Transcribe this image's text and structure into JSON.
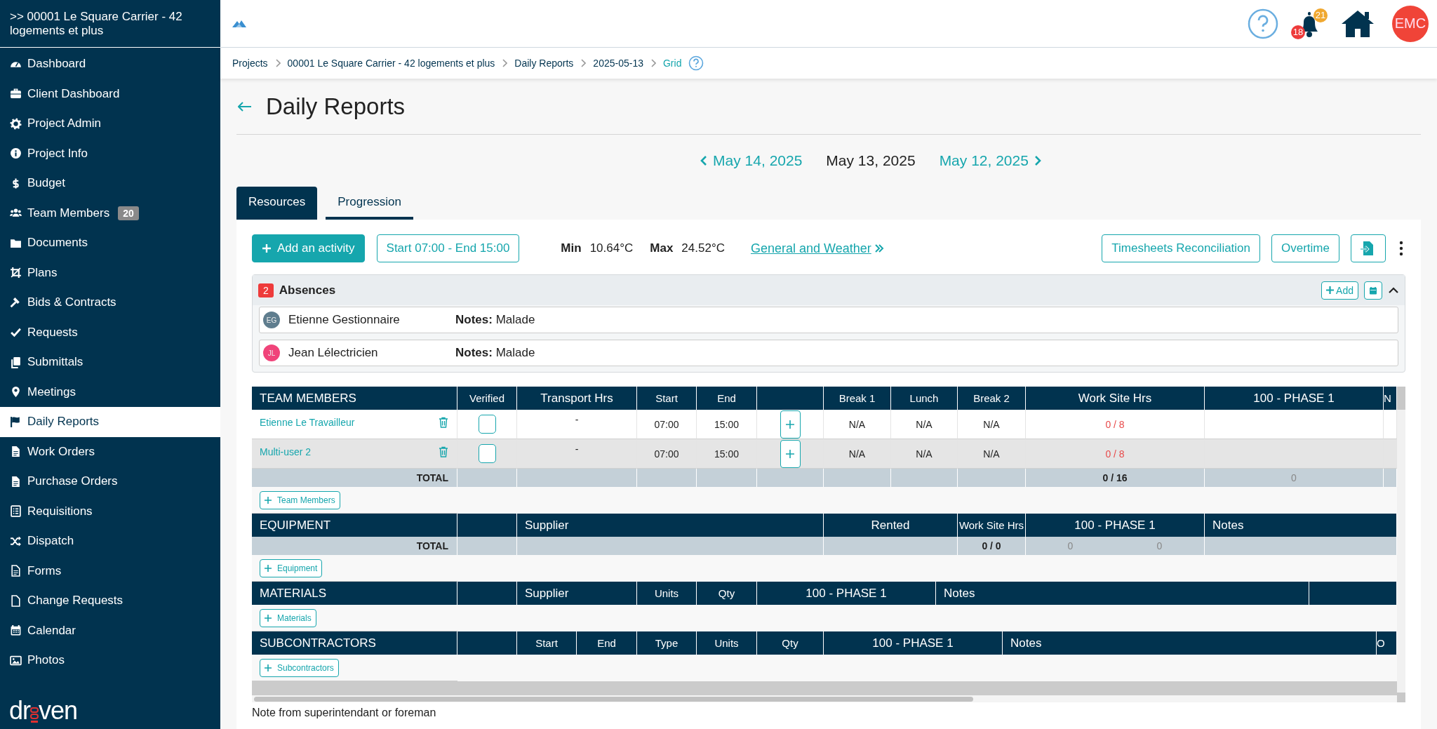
{
  "sidebar": {
    "project_title": ">> 00001 Le Square Carrier - 42 logements et plus",
    "items": [
      {
        "label": "Dashboard",
        "selected": false
      },
      {
        "label": "Client Dashboard",
        "selected": false
      },
      {
        "label": "Project Admin",
        "selected": false
      },
      {
        "label": "Project Info",
        "selected": false
      },
      {
        "label": "Budget",
        "selected": false
      },
      {
        "label": "Team Members",
        "badge": "20",
        "selected": false
      },
      {
        "label": "Documents",
        "selected": false
      },
      {
        "label": "Plans",
        "selected": false
      },
      {
        "label": "Bids & Contracts",
        "selected": false
      },
      {
        "label": "Requests",
        "selected": false
      },
      {
        "label": "Submittals",
        "selected": false
      },
      {
        "label": "Meetings",
        "selected": false
      },
      {
        "label": "Daily Reports",
        "selected": true
      },
      {
        "label": "Work Orders",
        "selected": false
      },
      {
        "label": "Purchase Orders",
        "selected": false
      },
      {
        "label": "Requisitions",
        "selected": false
      },
      {
        "label": "Dispatch",
        "selected": false
      },
      {
        "label": "Forms",
        "selected": false
      },
      {
        "label": "Change Requests",
        "selected": false
      },
      {
        "label": "Calendar",
        "selected": false
      },
      {
        "label": "Photos",
        "selected": false
      }
    ],
    "logo": {
      "start": "dr",
      "end": "ven"
    }
  },
  "top_bar": {
    "notifications": {
      "upper_count": "21",
      "lower_count": "18"
    },
    "avatar": "EMC"
  },
  "breadcrumb": [
    {
      "label": "Projects",
      "current": false
    },
    {
      "label": "00001 Le Square Carrier - 42 logements et plus",
      "current": false
    },
    {
      "label": "Daily Reports",
      "current": false
    },
    {
      "label": "2025-05-13",
      "current": false
    },
    {
      "label": "Grid",
      "current": true
    }
  ],
  "page_title": "Daily Reports",
  "date_nav": {
    "previous": "May 14, 2025",
    "current": "May 13, 2025",
    "next": "May 12, 2025"
  },
  "tabs": [
    {
      "label": "Resources",
      "selected": true
    },
    {
      "label": "Progression",
      "selected": false
    }
  ],
  "toolbar": {
    "add_activity": "Add an activity",
    "schedule": "Start 07:00 - End 15:00",
    "min_label": "Min",
    "min_value": "10.64°C",
    "max_label": "Max",
    "max_value": "24.52°C",
    "weather_link": "General and Weather",
    "reconciliation": "Timesheets Reconciliation",
    "overtime": "Overtime"
  },
  "absences": {
    "count": "2",
    "title": "Absences",
    "add": "Add",
    "expanded": true,
    "items": [
      {
        "initials": "EG",
        "color": "#5f7d8e",
        "name": "Etienne Gestionnaire",
        "notes": "**Notes:** Malade"
      },
      {
        "initials": "JL",
        "color": "#f0447a",
        "name": "Jean Lélectricien",
        "notes": "**Notes:** Malade"
      }
    ]
  },
  "sections": [
    {
      "kind": "team",
      "title": "TEAM MEMBERS",
      "columns": [
        {
          "label": "Verified"
        },
        {
          "label": "Transport Hrs"
        },
        {
          "label": "Start"
        },
        {
          "label": "End"
        },
        {
          "label": "Break 1"
        },
        {
          "label": "Lunch"
        },
        {
          "label": "Break 2"
        },
        {
          "label": "Work Site Hrs"
        },
        {
          "label": "100 - PHASE 1"
        },
        {
          "label": "N"
        }
      ],
      "rows": [
        {
          "name": "Etienne Le Travailleur",
          "verified": false,
          "transport": "-",
          "start": "07:00",
          "end": "15:00",
          "break_1": "N/A",
          "lunch": "N/A",
          "break_2": "N/A",
          "work_site_hrs": "0 / 8"
        },
        {
          "name": "Multi-user 2",
          "verified": false,
          "transport": "-",
          "start": "07:00",
          "end": "15:00",
          "break_1": "N/A",
          "lunch": "N/A",
          "break_2": "N/A",
          "work_site_hrs": "0 / 8"
        }
      ],
      "total": {
        "label": "TOTAL",
        "work_site_hrs": "0 / 16",
        "phase_1": [
          "0"
        ]
      },
      "add_button": "Team Members"
    },
    {
      "kind": "equipment",
      "title": "EQUIPMENT",
      "columns": [
        {
          "label": "Supplier"
        },
        {
          "label": "Rented"
        },
        {
          "label": "Work Site Hrs"
        },
        {
          "label": "100 - PHASE 1"
        },
        {
          "label": "Notes"
        }
      ],
      "total": {
        "label": "TOTAL",
        "work_site_hrs": "0 / 0",
        "phase_1": [
          "0",
          "0"
        ]
      },
      "add_button": "Equipment"
    },
    {
      "kind": "materials",
      "title": "MATERIALS",
      "columns": [
        {
          "label": "Supplier"
        },
        {
          "label": "Units"
        },
        {
          "label": "Qty"
        },
        {
          "label": "100 - PHASE 1"
        },
        {
          "label": "Notes"
        }
      ],
      "add_button": "Materials"
    },
    {
      "kind": "subcontractors",
      "title": "SUBCONTRACTORS",
      "columns": [
        {
          "label": "Start"
        },
        {
          "label": "End"
        },
        {
          "label": "Type"
        },
        {
          "label": "Units"
        },
        {
          "label": "Qty"
        },
        {
          "label": "100 - PHASE 1"
        },
        {
          "label": "Notes"
        },
        {
          "label": "O"
        }
      ],
      "add_button": "Subcontractors"
    }
  ],
  "note_label": "Note from superintendant or foreman"
}
